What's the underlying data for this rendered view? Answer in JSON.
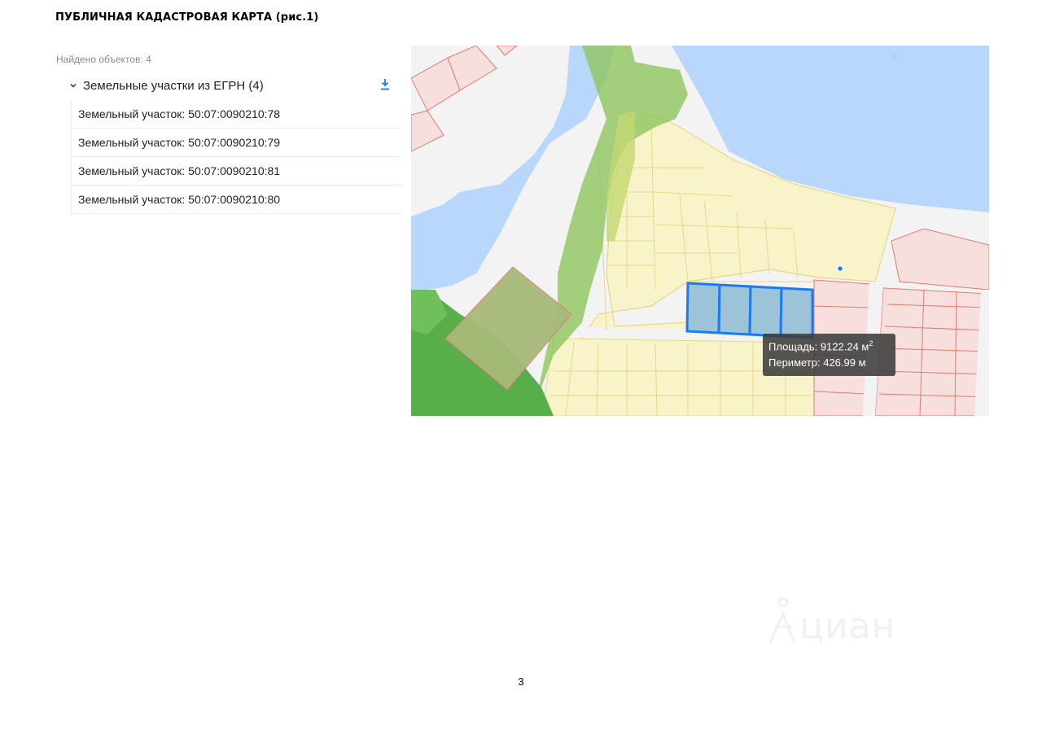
{
  "document": {
    "title": "ПУБЛИЧНАЯ КАДАСТРОВАЯ КАРТА (рис.1)",
    "page_number": "3"
  },
  "panel": {
    "found_count": "Найдено объектов: 4",
    "layer": {
      "title": "Земельные участки из ЕГРН (4)",
      "expand_icon": "chevron-down-icon",
      "download_icon": "download-icon",
      "items": [
        "Земельный участок: 50:07:0090210:78",
        "Земельный участок: 50:07:0090210:79",
        "Земельный участок: 50:07:0090210:81",
        "Земельный участок: 50:07:0090210:80"
      ]
    }
  },
  "map": {
    "tooltip": {
      "area_text": "Площадь: 9122.24 м",
      "area_unit_superscript": "2",
      "perimeter_text": "Периметр: 426.99 м"
    },
    "colors": {
      "water": "#b9d7fb",
      "parcel_fill": "#f8f3c9",
      "parcel_stroke": "#e4d98b",
      "forest": "#57ae4b",
      "green_zone": "#8fc45e",
      "zone_red_fill": "#f6dfdc",
      "zone_red_stroke": "#e47a72",
      "selection": "#1a7bf0",
      "road": "#f3f3f3"
    }
  },
  "watermark": {
    "text": "циан"
  }
}
